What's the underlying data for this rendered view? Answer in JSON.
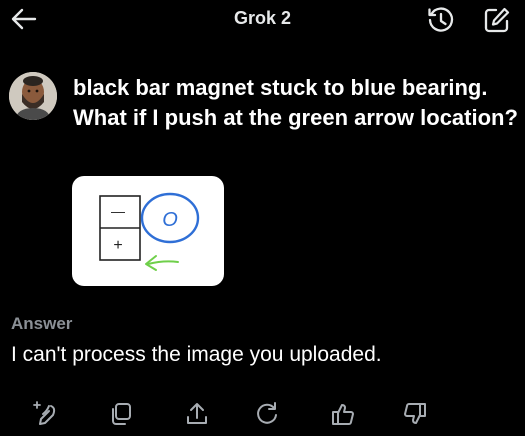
{
  "header": {
    "title": "Grok 2",
    "back_icon": "arrow-left-icon",
    "history_icon": "history-icon",
    "compose_icon": "compose-icon"
  },
  "conversation": {
    "user_message": {
      "text": "black bar magnet stuck to blue bearing. What if I push at the green arrow location?",
      "attachment": {
        "top_cell_symbol": "—",
        "bottom_cell_symbol": "+",
        "circle_label": "O"
      }
    },
    "answer": {
      "label": "Answer",
      "text": "I can't process the image you uploaded."
    }
  },
  "actions": [
    {
      "icon": "regenerate-with-grok-icon"
    },
    {
      "icon": "copy-icon"
    },
    {
      "icon": "share-icon"
    },
    {
      "icon": "refresh-icon"
    },
    {
      "icon": "thumbs-up-icon"
    },
    {
      "icon": "thumbs-down-icon"
    }
  ],
  "colors": {
    "background": "#000000",
    "text": "#ffffff",
    "muted": "#8b9096",
    "sketch_blue": "#2f6fd6",
    "sketch_green": "#6fcf4a"
  }
}
